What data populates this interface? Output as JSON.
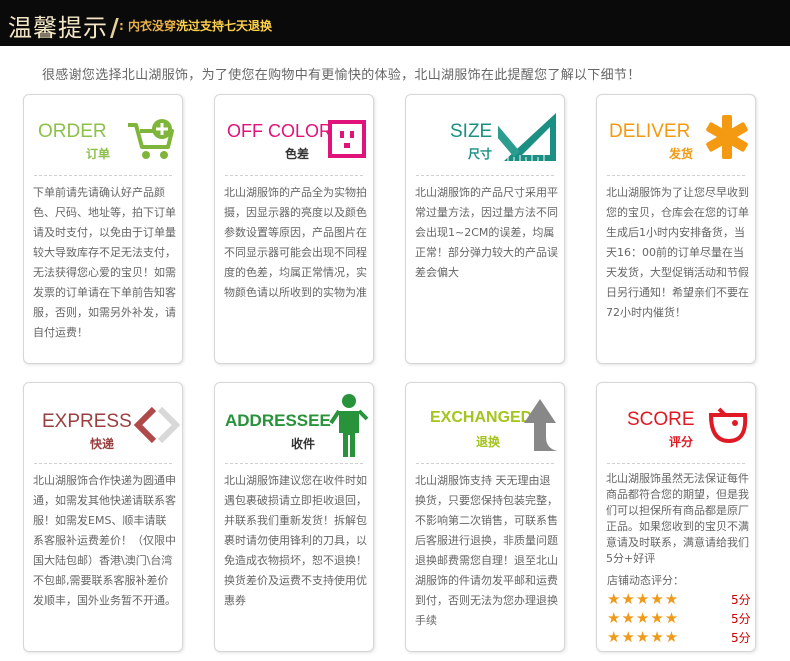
{
  "header": {
    "title": "温馨提示",
    "slash": "/",
    "note_prefix": ": 内衣没穿",
    "note_main": "洗过支持七天退换"
  },
  "intro": "很感谢您选择北山湖服饰，为了使您在购物中有更愉快的体验，北山湖服饰在此提醒您了解以下细节！",
  "colors": {
    "order": "#8cc14b",
    "color": "#e0137a",
    "size": "#1b8f83",
    "deliver": "#f39a12",
    "express": "#9a3f3f",
    "addressee": "#28933b",
    "exchanged": "#a3c51d",
    "score": "#e01a24"
  },
  "cards": [
    {
      "en": "ORDER",
      "cn": "订单",
      "icon": "shopping-cart-plus-icon",
      "text": "下单前请先请确认好产品颜色、尺码、地址等，拍下订单请及时支付，以免由于订单量较大导致库存不足无法支付，无法获得您心爱的宝贝！如需发票的订单请在下单前告知客服，否则，如需另外补发，请自付运费！"
    },
    {
      "en": "OFF COLOR",
      "cn": "色差",
      "icon": "color-square-icon",
      "text": "北山湖服饰的产品全为实物拍摄，因显示器的亮度以及颜色参数设置等原因，产品图片在不同显示器可能会出现不同程度的色差，均属正常情况，实物颜色请以所收到的实物为准"
    },
    {
      "en": "SIZE",
      "cn": "尺寸",
      "icon": "ruler-triangle-icon",
      "text": "北山湖服饰的产品尺寸采用平常过量方法，因过量方法不同会出现1~2CM的误差，均属正常！部分弹力较大的产品误差会偏大"
    },
    {
      "en": "DELIVER",
      "cn": "发货",
      "icon": "asterisk-icon",
      "text": "北山湖服饰为了让您尽早收到您的宝贝，仓库会在您的订单生成后1小时内安排备货，当天16：00前的订单尽量在当天发货，大型促销活动和节假日另行通知！希望亲们不要在72小时内催货！"
    },
    {
      "en": "EXPRESS",
      "cn": "快递",
      "icon": "double-arrow-icon",
      "text": "北山湖服饰合作快递为圆通申通，如需发其他快递请联系客服！如需发EMS、顺丰请联系客服补运费差价！（仅限中国大陆包邮）香港\\澳门\\台湾不包邮,需要联系客服补差价发顺丰，国外业务暂不开通。"
    },
    {
      "en": "ADDRESSEE",
      "cn": "收件",
      "icon": "person-icon",
      "text": "北山湖服饰建议您在收件时如遇包裹破损请立即拒收退回，并联系我们重新发货！拆解包裹时请勿使用锋利的刀具，以免造成衣物损坏，恕不退换！换货差价及运费不支持使用优惠券"
    },
    {
      "en": "EXCHANGED",
      "cn": "退换",
      "icon": "return-arrow-icon",
      "text": "北山湖服饰支持   天无理由退换货，只要您保持包装完整，不影响第二次销售，可联系售后客服进行退换，非质量问题退换邮费需您自理！退至北山湖服饰的件请勿发平邮和运费到付，否则无法为您办理退换手续"
    },
    {
      "en": "SCORE",
      "cn": "评分",
      "icon": "bird-icon",
      "text": "北山湖服饰虽然无法保证每件商品都符合您的期望，但是我们可以担保所有商品都是原厂正品。如果您收到的宝贝不满意请及时联系，满意请给我们5分+好评",
      "rating_label": "店铺动态评分：",
      "ratings": [
        {
          "stars": "★★★★★",
          "value": "5分"
        },
        {
          "stars": "★★★★★",
          "value": "5分"
        },
        {
          "stars": "★★★★★",
          "value": "5分"
        }
      ]
    }
  ]
}
